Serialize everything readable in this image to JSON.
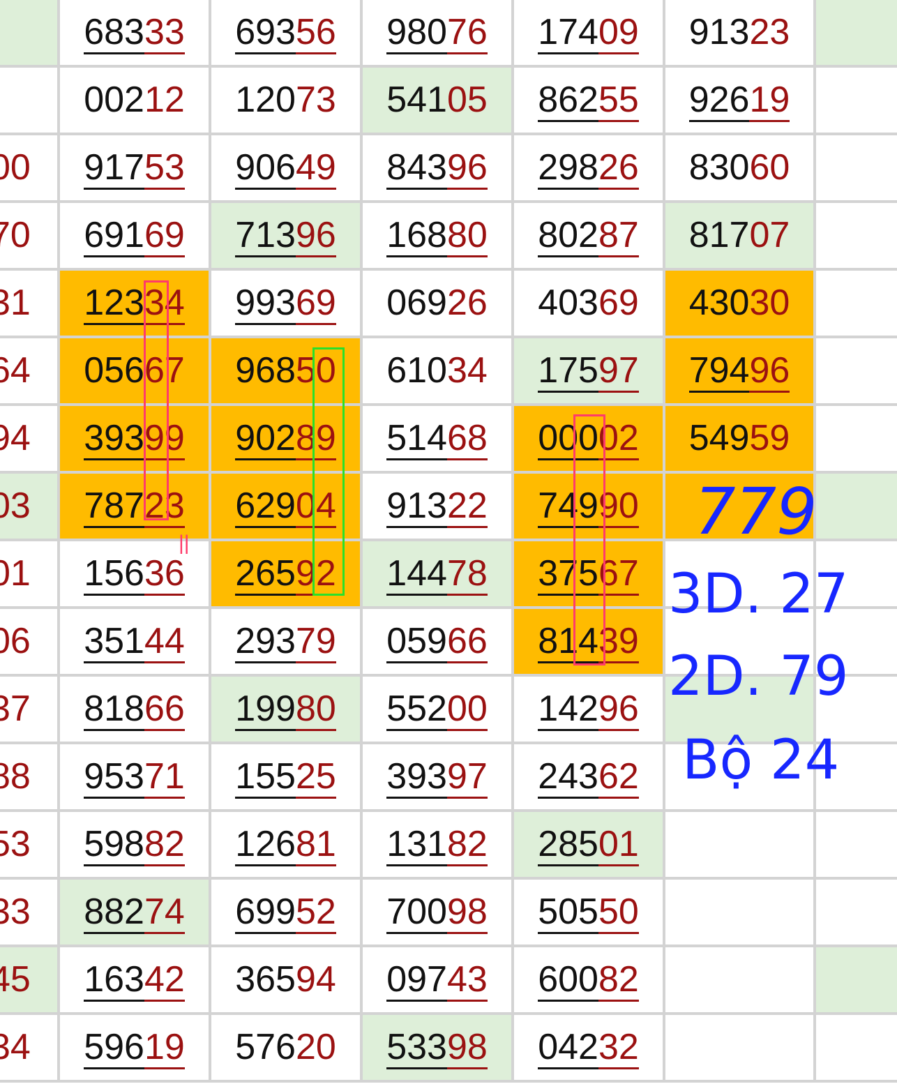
{
  "grid": {
    "rows": [
      {
        "edge": {
          "h": "",
          "t": "",
          "bg": "green"
        },
        "cells": [
          {
            "h": "683",
            "t": "33",
            "bg": "white",
            "ul": true
          },
          {
            "h": "693",
            "t": "56",
            "bg": "white",
            "ul": true
          },
          {
            "h": "980",
            "t": "76",
            "bg": "white",
            "ul": true
          },
          {
            "h": "174",
            "t": "09",
            "bg": "white",
            "ul": true
          },
          {
            "h": "913",
            "t": "23",
            "bg": "white",
            "ul": false
          }
        ],
        "tail": {
          "bg": "green"
        }
      },
      {
        "edge": {
          "h": "",
          "t": "",
          "bg": "white"
        },
        "cells": [
          {
            "h": "002",
            "t": "12",
            "bg": "white",
            "ul": false
          },
          {
            "h": "120",
            "t": "73",
            "bg": "white",
            "ul": false
          },
          {
            "h": "541",
            "t": "05",
            "bg": "green",
            "ul": false
          },
          {
            "h": "862",
            "t": "55",
            "bg": "white",
            "ul": true
          },
          {
            "h": "926",
            "t": "19",
            "bg": "white",
            "ul": true
          }
        ],
        "tail": {
          "bg": "white"
        }
      },
      {
        "edge": {
          "h": "",
          "t": "00",
          "bg": "white"
        },
        "cells": [
          {
            "h": "917",
            "t": "53",
            "bg": "white",
            "ul": true
          },
          {
            "h": "906",
            "t": "49",
            "bg": "white",
            "ul": true
          },
          {
            "h": "843",
            "t": "96",
            "bg": "white",
            "ul": true
          },
          {
            "h": "298",
            "t": "26",
            "bg": "white",
            "ul": true
          },
          {
            "h": "830",
            "t": "60",
            "bg": "white",
            "ul": false
          }
        ],
        "tail": {
          "bg": "white"
        }
      },
      {
        "edge": {
          "h": "",
          "t": "70",
          "bg": "white"
        },
        "cells": [
          {
            "h": "691",
            "t": "69",
            "bg": "white",
            "ul": true
          },
          {
            "h": "713",
            "t": "96",
            "bg": "green",
            "ul": true
          },
          {
            "h": "168",
            "t": "80",
            "bg": "white",
            "ul": true
          },
          {
            "h": "802",
            "t": "87",
            "bg": "white",
            "ul": true
          },
          {
            "h": "817",
            "t": "07",
            "bg": "green",
            "ul": false
          }
        ],
        "tail": {
          "bg": "white"
        }
      },
      {
        "edge": {
          "h": "",
          "t": "31",
          "bg": "white"
        },
        "cells": [
          {
            "h": "123",
            "t": "34",
            "bg": "orange",
            "ul": true
          },
          {
            "h": "993",
            "t": "69",
            "bg": "white",
            "ul": true
          },
          {
            "h": "069",
            "t": "26",
            "bg": "white",
            "ul": false
          },
          {
            "h": "403",
            "t": "69",
            "bg": "white",
            "ul": false
          },
          {
            "h": "430",
            "t": "30",
            "bg": "orange",
            "ul": false
          }
        ],
        "tail": {
          "bg": "white"
        }
      },
      {
        "edge": {
          "h": "",
          "t": "64",
          "bg": "white"
        },
        "cells": [
          {
            "h": "056",
            "t": "67",
            "bg": "orange",
            "ul": false
          },
          {
            "h": "968",
            "t": "50",
            "bg": "orange",
            "ul": false
          },
          {
            "h": "610",
            "t": "34",
            "bg": "white",
            "ul": false
          },
          {
            "h": "175",
            "t": "97",
            "bg": "green",
            "ul": true
          },
          {
            "h": "794",
            "t": "96",
            "bg": "orange",
            "ul": true
          }
        ],
        "tail": {
          "bg": "white"
        }
      },
      {
        "edge": {
          "h": "",
          "t": "94",
          "bg": "white"
        },
        "cells": [
          {
            "h": "393",
            "t": "99",
            "bg": "orange",
            "ul": true
          },
          {
            "h": "902",
            "t": "89",
            "bg": "orange",
            "ul": true
          },
          {
            "h": "514",
            "t": "68",
            "bg": "white",
            "ul": true
          },
          {
            "h": "000",
            "t": "02",
            "bg": "orange",
            "ul": true
          },
          {
            "h": "549",
            "t": "59",
            "bg": "orange",
            "ul": false
          }
        ],
        "tail": {
          "bg": "white"
        }
      },
      {
        "edge": {
          "h": "",
          "t": "03",
          "bg": "green"
        },
        "cells": [
          {
            "h": "787",
            "t": "23",
            "bg": "orange",
            "ul": true
          },
          {
            "h": "629",
            "t": "04",
            "bg": "orange",
            "ul": true
          },
          {
            "h": "913",
            "t": "22",
            "bg": "white",
            "ul": true
          },
          {
            "h": "749",
            "t": "90",
            "bg": "orange",
            "ul": true
          },
          {
            "h": "",
            "t": "",
            "bg": "orange",
            "ul": false
          }
        ],
        "tail": {
          "bg": "green"
        }
      },
      {
        "edge": {
          "h": "",
          "t": "01",
          "bg": "white"
        },
        "cells": [
          {
            "h": "156",
            "t": "36",
            "bg": "white",
            "ul": true
          },
          {
            "h": "265",
            "t": "92",
            "bg": "orange",
            "ul": true
          },
          {
            "h": "144",
            "t": "78",
            "bg": "green",
            "ul": true
          },
          {
            "h": "375",
            "t": "67",
            "bg": "orange",
            "ul": true
          },
          {
            "h": "",
            "t": "",
            "bg": "white",
            "ul": false
          }
        ],
        "tail": {
          "bg": "white"
        }
      },
      {
        "edge": {
          "h": "",
          "t": "06",
          "bg": "white"
        },
        "cells": [
          {
            "h": "351",
            "t": "44",
            "bg": "white",
            "ul": true
          },
          {
            "h": "293",
            "t": "79",
            "bg": "white",
            "ul": true
          },
          {
            "h": "059",
            "t": "66",
            "bg": "white",
            "ul": true
          },
          {
            "h": "814",
            "t": "39",
            "bg": "orange",
            "ul": true
          },
          {
            "h": "",
            "t": "",
            "bg": "white",
            "ul": false
          }
        ],
        "tail": {
          "bg": "white"
        }
      },
      {
        "edge": {
          "h": "",
          "t": "37",
          "bg": "white"
        },
        "cells": [
          {
            "h": "818",
            "t": "66",
            "bg": "white",
            "ul": true
          },
          {
            "h": "199",
            "t": "80",
            "bg": "green",
            "ul": true
          },
          {
            "h": "552",
            "t": "00",
            "bg": "white",
            "ul": true
          },
          {
            "h": "142",
            "t": "96",
            "bg": "white",
            "ul": true
          },
          {
            "h": "",
            "t": "",
            "bg": "green",
            "ul": false
          }
        ],
        "tail": {
          "bg": "white"
        }
      },
      {
        "edge": {
          "h": "",
          "t": "88",
          "bg": "white"
        },
        "cells": [
          {
            "h": "953",
            "t": "71",
            "bg": "white",
            "ul": true
          },
          {
            "h": "155",
            "t": "25",
            "bg": "white",
            "ul": true
          },
          {
            "h": "393",
            "t": "97",
            "bg": "white",
            "ul": true
          },
          {
            "h": "243",
            "t": "62",
            "bg": "white",
            "ul": true
          },
          {
            "h": "",
            "t": "",
            "bg": "white",
            "ul": false
          }
        ],
        "tail": {
          "bg": "white"
        }
      },
      {
        "edge": {
          "h": "",
          "t": "53",
          "bg": "white"
        },
        "cells": [
          {
            "h": "598",
            "t": "82",
            "bg": "white",
            "ul": true
          },
          {
            "h": "126",
            "t": "81",
            "bg": "white",
            "ul": true
          },
          {
            "h": "131",
            "t": "82",
            "bg": "white",
            "ul": true
          },
          {
            "h": "285",
            "t": "01",
            "bg": "green",
            "ul": true
          },
          {
            "h": "",
            "t": "",
            "bg": "white",
            "ul": false
          }
        ],
        "tail": {
          "bg": "white"
        }
      },
      {
        "edge": {
          "h": "",
          "t": "33",
          "bg": "white"
        },
        "cells": [
          {
            "h": "882",
            "t": "74",
            "bg": "green",
            "ul": true
          },
          {
            "h": "699",
            "t": "52",
            "bg": "white",
            "ul": true
          },
          {
            "h": "700",
            "t": "98",
            "bg": "white",
            "ul": true
          },
          {
            "h": "505",
            "t": "50",
            "bg": "white",
            "ul": true
          },
          {
            "h": "",
            "t": "",
            "bg": "white",
            "ul": false
          }
        ],
        "tail": {
          "bg": "white"
        }
      },
      {
        "edge": {
          "h": "",
          "t": "45",
          "bg": "green"
        },
        "cells": [
          {
            "h": "163",
            "t": "42",
            "bg": "white",
            "ul": true
          },
          {
            "h": "365",
            "t": "94",
            "bg": "white",
            "ul": false
          },
          {
            "h": "097",
            "t": "43",
            "bg": "white",
            "ul": true
          },
          {
            "h": "600",
            "t": "82",
            "bg": "white",
            "ul": true
          },
          {
            "h": "",
            "t": "",
            "bg": "white",
            "ul": false
          }
        ],
        "tail": {
          "bg": "green"
        }
      },
      {
        "edge": {
          "h": "",
          "t": "34",
          "bg": "white"
        },
        "cells": [
          {
            "h": "596",
            "t": "19",
            "bg": "white",
            "ul": true
          },
          {
            "h": "576",
            "t": "20",
            "bg": "white",
            "ul": false
          },
          {
            "h": "533",
            "t": "98",
            "bg": "green",
            "ul": true
          },
          {
            "h": "042",
            "t": "32",
            "bg": "white",
            "ul": true
          },
          {
            "h": "",
            "t": "",
            "bg": "white",
            "ul": false
          }
        ],
        "tail": {
          "bg": "white"
        }
      }
    ]
  },
  "annotations": {
    "main": "779",
    "line1": "3D. 27",
    "line2": "2D. 79",
    "line3": "Bộ 24",
    "mark": "||"
  },
  "colors": {
    "orange": "#ffbb00",
    "green": "#deefd9",
    "tail_digits": "#9b1111",
    "note_blue": "#1727ff",
    "box_red": "#ff3b6a",
    "box_lime": "#29e02b"
  }
}
